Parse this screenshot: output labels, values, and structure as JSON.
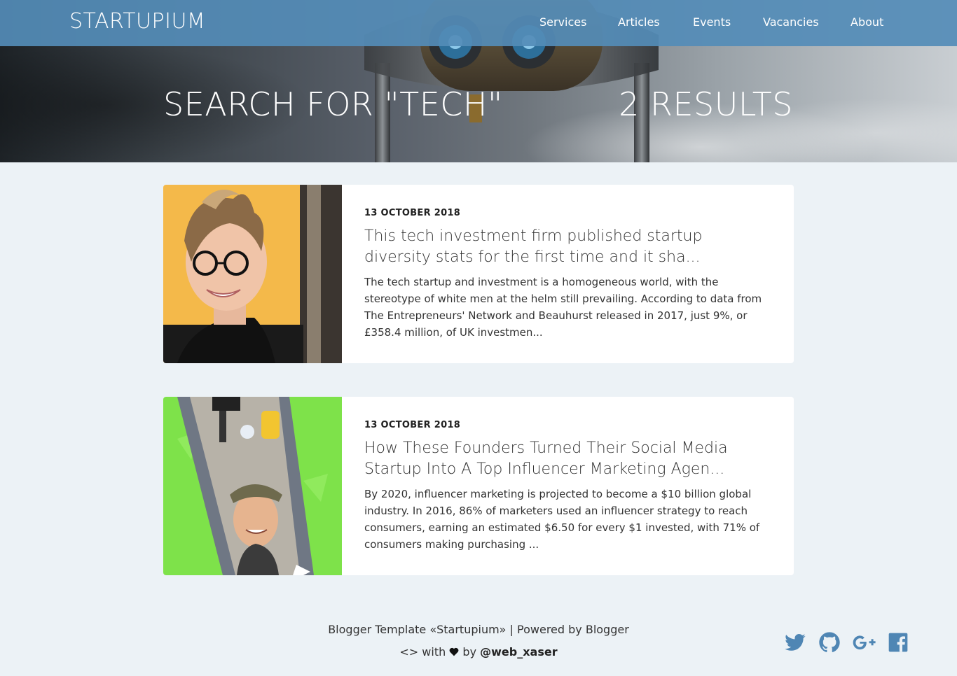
{
  "site": {
    "logo": "STARTUPIUM"
  },
  "nav": {
    "items": [
      {
        "label": "Services"
      },
      {
        "label": "Articles"
      },
      {
        "label": "Events"
      },
      {
        "label": "Vacancies"
      },
      {
        "label": "About"
      }
    ]
  },
  "hero": {
    "title": "SEARCH FOR \"TECH\"",
    "count": "2 RESULTS"
  },
  "results": [
    {
      "date": "13 OCTOBER 2018",
      "title": "This tech investment firm published startup diversity stats for the first time and it sha...",
      "excerpt": "The tech startup and investment is a homogeneous world, with the stereotype of white men at the helm still prevailing. According to data from The Entrepreneurs' Network and Beauhurst released in 2017, just 9%, or £358.4 million, of UK investmen..."
    },
    {
      "date": "13 OCTOBER 2018",
      "title": "How These Founders Turned Their Social Media Startup Into A Top Influencer Marketing Agen...",
      "excerpt": "By 2020, influencer marketing is projected to become a $10 billion global industry. In 2016, 86% of marketers used an influencer strategy to reach consumers, earning an estimated $6.50 for every $1 invested, with 71% of consumers making purchasing ..."
    }
  ],
  "footer": {
    "credit": "Blogger Template «Startupium» | Powered by Blogger",
    "code_glyph": "<>",
    "with_text": "with",
    "by_text": "by",
    "handle": "@web_xaser",
    "social": [
      "twitter-icon",
      "github-icon",
      "google-plus-icon",
      "facebook-icon"
    ]
  },
  "colors": {
    "topbar": "#548cb7",
    "page_bg": "#ecf2f6",
    "social": "#4f86b4"
  }
}
